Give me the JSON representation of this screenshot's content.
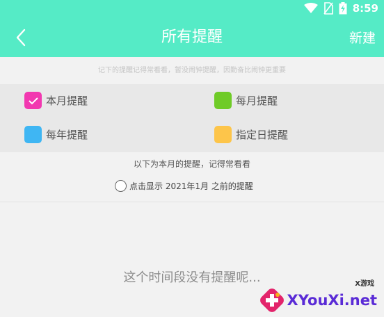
{
  "status": {
    "time": "8:59"
  },
  "header": {
    "title": "所有提醒",
    "new_label": "新建"
  },
  "hint": "记下的提醒记得常看看，暂没闹钟提醒，因勤奋比闹钟更重要",
  "legend": [
    {
      "label": "本月提醒",
      "color": "#f238b0",
      "checked": true
    },
    {
      "label": "每月提醒",
      "color": "#6fcb27",
      "checked": false
    },
    {
      "label": "每年提醒",
      "color": "#3fb6f3",
      "checked": false
    },
    {
      "label": "指定日提醒",
      "color": "#fdc54a",
      "checked": false
    }
  ],
  "month_note": "以下为本月的提醒，记得常看看",
  "show_before": "点击显示 2021年1月 之前的提醒",
  "empty_text": "这个时间段没有提醒呢...",
  "watermark": {
    "text": "XYouXi.net",
    "small": "X游戏"
  }
}
